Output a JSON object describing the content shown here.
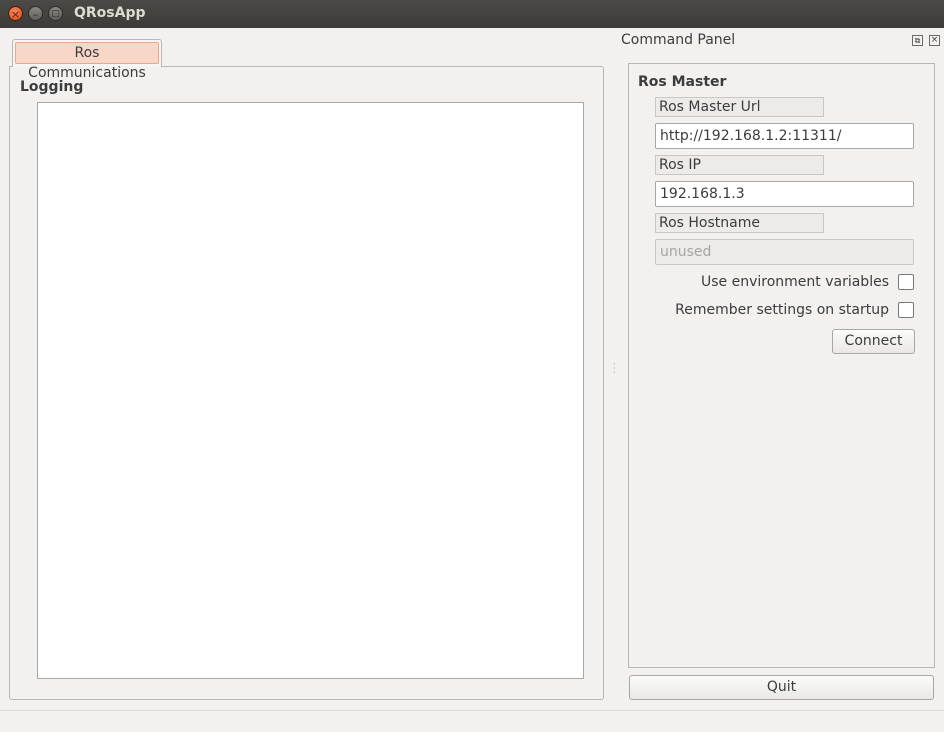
{
  "window": {
    "title": "QRosApp",
    "buttons": {
      "close": "×",
      "minimize": "–",
      "maximize": "□"
    }
  },
  "tabs": [
    {
      "label": "Ros Communications",
      "selected": true
    }
  ],
  "logging": {
    "title": "Logging"
  },
  "dock": {
    "title": "Command Panel",
    "float_icon": "restore-icon",
    "close_icon": "close-icon"
  },
  "ros_master": {
    "title": "Ros Master",
    "master_url_label": "Ros Master Url",
    "master_url_value": "http://192.168.1.2:11311/",
    "ip_label": "Ros IP",
    "ip_value": "192.168.1.3",
    "hostname_label": "Ros Hostname",
    "hostname_value": "unused",
    "use_env_label": "Use environment variables",
    "use_env_checked": false,
    "remember_label": "Remember settings on startup",
    "remember_checked": false,
    "connect_label": "Connect"
  },
  "quit_label": "Quit",
  "colors": {
    "accent": "#dd4814",
    "tab_highlight": "#f8d7c9",
    "window_bg": "#f2f1f0",
    "titlebar": "#3c3b37"
  }
}
